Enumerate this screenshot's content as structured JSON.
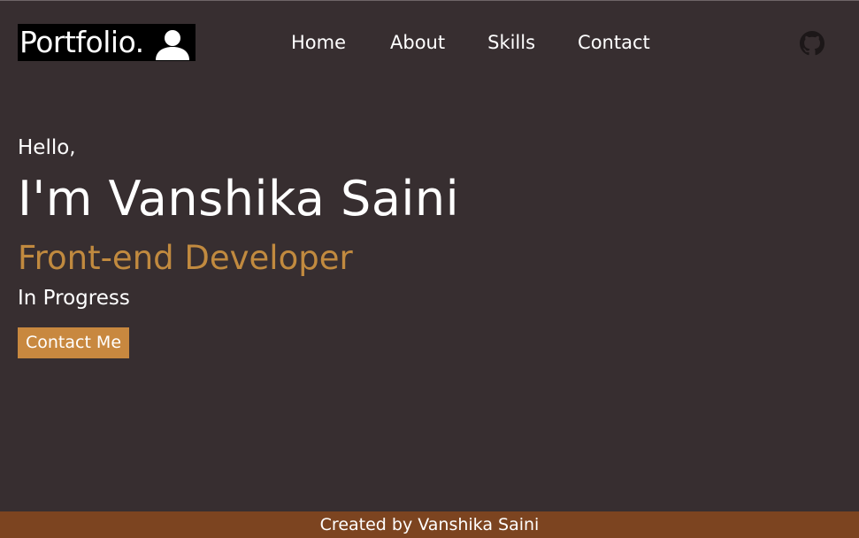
{
  "header": {
    "logo_text": "Portfolio.",
    "logo_icon": "user-icon",
    "nav": [
      {
        "label": "Home"
      },
      {
        "label": "About"
      },
      {
        "label": "Skills"
      },
      {
        "label": "Contact"
      }
    ],
    "github_icon": "github-icon"
  },
  "hero": {
    "greeting": "Hello,",
    "name": "I'm Vanshika Saini",
    "role": "Front-end Developer",
    "status": "In Progress",
    "cta_label": "Contact Me"
  },
  "footer": {
    "text": "Created by Vanshika Saini"
  },
  "colors": {
    "background": "#372e30",
    "accent": "#c8883f",
    "role_text": "#c18a3f",
    "footer_bg": "#7c4420"
  }
}
